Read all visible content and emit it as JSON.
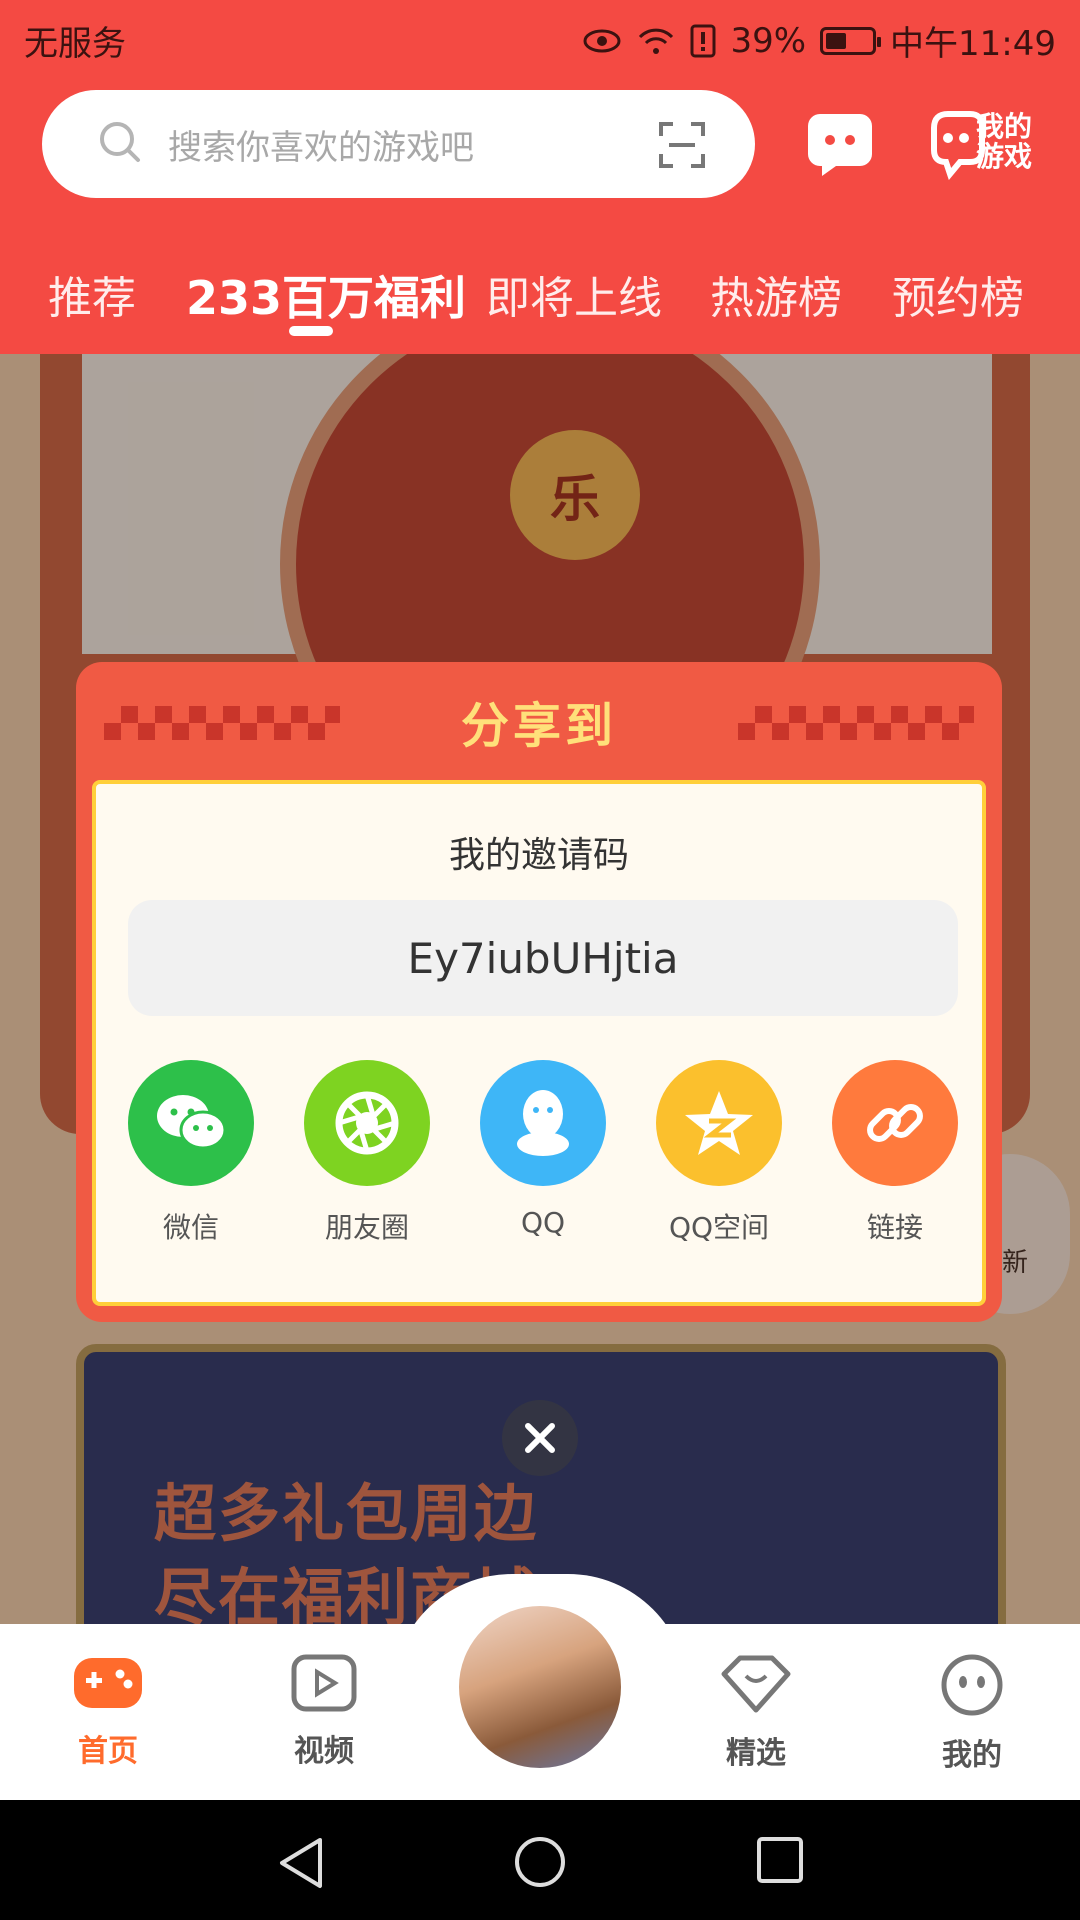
{
  "status_bar": {
    "carrier": "无服务",
    "battery": "39%",
    "time": "中午11:49"
  },
  "header": {
    "search_placeholder": "搜索你喜欢的游戏吧",
    "my_games_label": "我的游戏",
    "tabs": [
      "推荐",
      "233百万福利",
      "即将上线",
      "热游榜",
      "预约榜"
    ],
    "active_tab": "233百万福利"
  },
  "background": {
    "wheel_center_text": "乐",
    "banner_title_line1": "超多礼包周边",
    "banner_title_line2": "尽在福利商城",
    "refresh_label": "新"
  },
  "share_dialog": {
    "title": "分享到",
    "code_label": "我的邀请码",
    "invite_code": "Ey7iubUHjtia",
    "options": [
      {
        "label": "微信",
        "icon": "wechat-icon",
        "color": "#2dc04a"
      },
      {
        "label": "朋友圈",
        "icon": "moments-icon",
        "color": "#7ed321"
      },
      {
        "label": "QQ",
        "icon": "qq-icon",
        "color": "#3eb6f7"
      },
      {
        "label": "QQ空间",
        "icon": "qzone-icon",
        "color": "#fbc02d"
      },
      {
        "label": "链接",
        "icon": "link-icon",
        "color": "#ff7a3d"
      }
    ]
  },
  "bottom_nav": {
    "items": [
      {
        "label": "首页",
        "active": true
      },
      {
        "label": "视频",
        "active": false
      },
      {
        "label": "精选",
        "active": false
      },
      {
        "label": "我的",
        "active": false
      }
    ]
  },
  "colors": {
    "brand_red": "#f44a43",
    "accent_orange": "#ff6b2c",
    "title_yellow": "#ffe07a"
  }
}
